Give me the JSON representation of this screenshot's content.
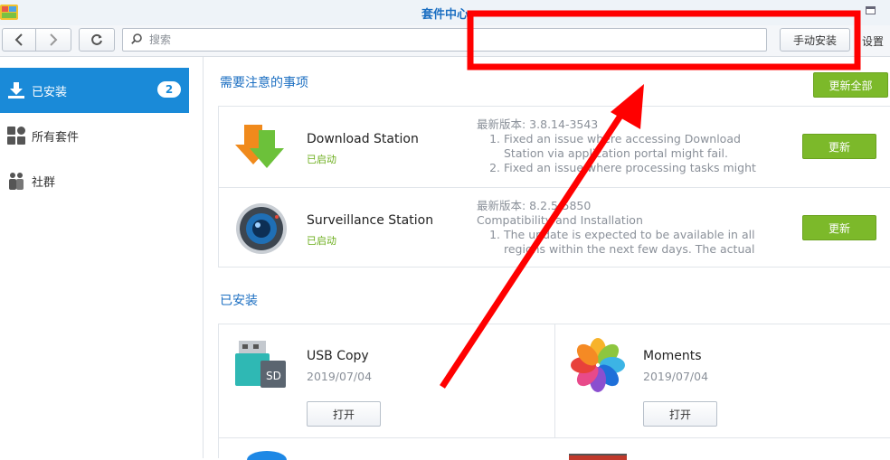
{
  "window": {
    "title": "套件中心"
  },
  "toolbar": {
    "search_placeholder": "搜索",
    "manual_install": "手动安装",
    "settings": "设置"
  },
  "sidebar": {
    "items": [
      {
        "label": "已安装",
        "badge": "2",
        "icon": "download-icon"
      },
      {
        "label": "所有套件",
        "icon": "grid-icon"
      },
      {
        "label": "社群",
        "icon": "community-icon"
      }
    ]
  },
  "main": {
    "updates_title": "需要注意的事项",
    "update_all": "更新全部",
    "updates": [
      {
        "name": "Download Station",
        "status": "已启动",
        "version_line": "最新版本: 3.8.14-3543",
        "intro": "",
        "notes": [
          "Fixed an issue where accessing Download Station via application portal might fail.",
          "Fixed an issue where processing tasks might"
        ],
        "button": "更新"
      },
      {
        "name": "Surveillance Station",
        "status": "已启动",
        "version_line": "最新版本: 8.2.5-5850",
        "intro": "Compatibility and Installation",
        "notes": [
          "The update is expected to be available in all regions within the next few days. The actual"
        ],
        "button": "更新"
      }
    ],
    "installed_title": "已安装",
    "installed": [
      {
        "name": "USB Copy",
        "date": "2019/07/04",
        "button": "打开"
      },
      {
        "name": "Moments",
        "date": "2019/07/04",
        "button": "打开"
      }
    ]
  },
  "colors": {
    "accent": "#1a8ad8",
    "green": "#7cb92a",
    "annotation_red": "#ff0000"
  }
}
